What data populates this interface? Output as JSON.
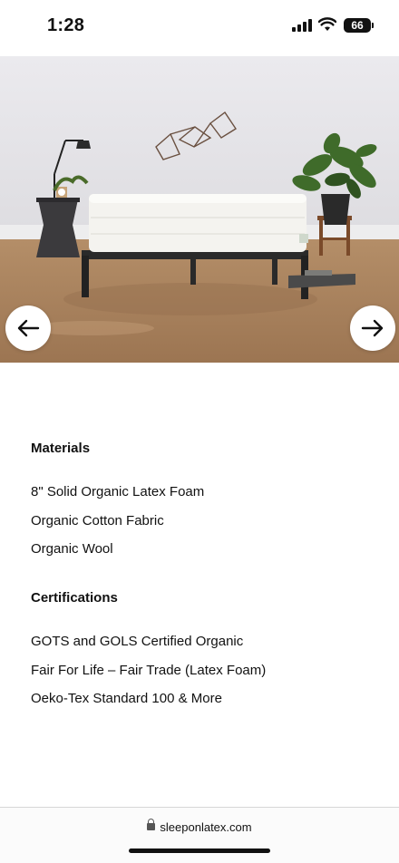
{
  "status_bar": {
    "time": "1:28",
    "battery": "66"
  },
  "hero": {
    "image_alt": "Latex mattress on a black metal bed frame in a room with plants and a lamp",
    "nav": {
      "prev_icon": "arrow-left-icon",
      "next_icon": "arrow-right-icon"
    }
  },
  "materials": {
    "heading": "Materials",
    "items": [
      "8\" Solid Organic Latex Foam",
      "Organic Cotton Fabric",
      "Organic Wool"
    ]
  },
  "certifications": {
    "heading": "Certifications",
    "items": [
      "GOTS and GOLS Certified Organic",
      "Fair For Life – Fair Trade (Latex Foam)",
      "Oeko-Tex Standard 100 & More"
    ]
  },
  "browser": {
    "url": "sleeponlatex.com",
    "lock_icon": "lock-icon"
  }
}
